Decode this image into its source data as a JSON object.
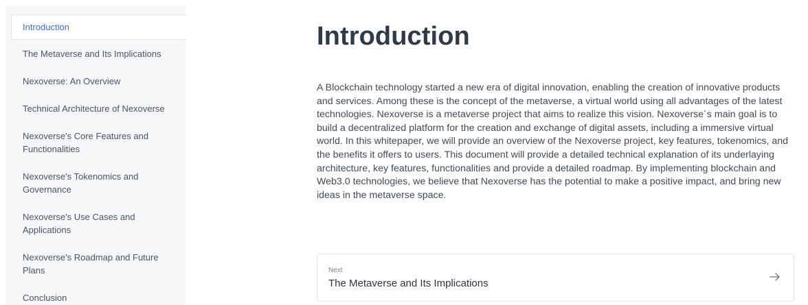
{
  "sidebar": {
    "items": [
      {
        "label": "Introduction",
        "active": true
      },
      {
        "label": "The Metaverse and Its Implications"
      },
      {
        "label": "Nexoverse: An Overview"
      },
      {
        "label": "Technical Architecture of Nexoverse"
      },
      {
        "label": "Nexoverse's Core Features and Functionalities"
      },
      {
        "label": "Nexoverse's Tokenomics and Governance"
      },
      {
        "label": "Nexoverse's Use Cases and Applications"
      },
      {
        "label": "Nexoverse's Roadmap and Future Plans"
      },
      {
        "label": "Conclusion"
      }
    ]
  },
  "main": {
    "title": "Introduction",
    "body": "A Blockchain technology started a new era of digital innovation, enabling the creation of innovative products and services. Among these is the concept of the metaverse, a virtual world using all advantages of the latest technologies. Nexoverse is a metaverse project that aims to realize this vision. Nexoverse´s main goal is to build a decentralized platform for the creation and exchange of digital assets, including a immersive virtual world. In this whitepaper, we will provide an overview of the Nexoverse project, key features, tokenomics, and the benefits it offers to users. This document will provide a detailed technical explanation of its underlaying architecture, key features, functionalities and provide a detailed roadmap. By implementing blockchain and Web3.0 technologies, we believe that Nexoverse has the potential to make a positive impact, and bring new ideas in the metaverse space.",
    "next": {
      "label": "Next",
      "title": "The Metaverse and Its Implications",
      "icon": "arrow-right-icon"
    }
  },
  "colors": {
    "accent": "#3f6fd6",
    "sidebar_bg": "#f6f7f9"
  }
}
